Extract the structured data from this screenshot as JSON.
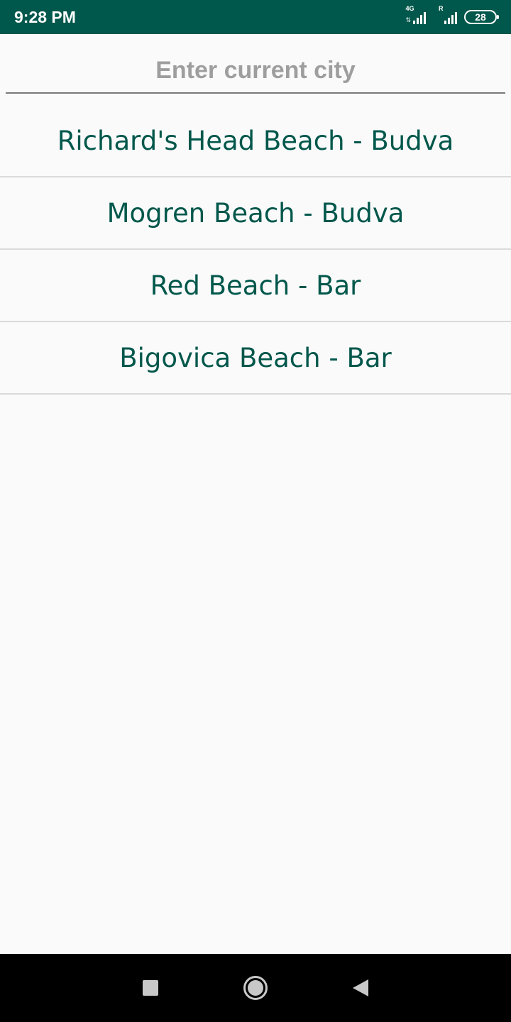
{
  "status_bar": {
    "time": "9:28 PM",
    "network_label": "4G",
    "roaming_label": "R",
    "battery_level": "28"
  },
  "search": {
    "placeholder": "Enter current city",
    "value": ""
  },
  "beaches": [
    {
      "label": "Richard's Head Beach - Budva"
    },
    {
      "label": "Mogren Beach - Budva"
    },
    {
      "label": "Red Beach - Bar"
    },
    {
      "label": "Bigovica Beach - Bar"
    }
  ],
  "navigation": {
    "recents_icon": "square-icon",
    "home_icon": "circle-icon",
    "back_icon": "triangle-left-icon"
  },
  "colors": {
    "accent": "#00574b",
    "placeholder": "#9e9e9e",
    "divider": "#dadada",
    "background": "#fafafa"
  }
}
